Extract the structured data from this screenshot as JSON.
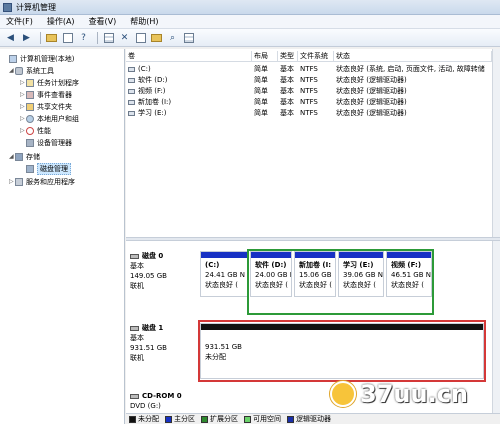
{
  "window": {
    "title": "计算机管理"
  },
  "menu": [
    "文件(F)",
    "操作(A)",
    "查看(V)",
    "帮助(H)"
  ],
  "toolbar": [
    "back-icon",
    "forward-icon",
    "sep",
    "up-folder-icon",
    "properties-icon",
    "help-icon",
    "sep",
    "grid-icon",
    "close-icon",
    "export-icon",
    "folder-icon",
    "search-icon",
    "screen-icon"
  ],
  "tree": [
    {
      "label": "计算机管理(本地)",
      "icon": "computer-icon",
      "level": 0,
      "twisty": ""
    },
    {
      "label": "系统工具",
      "icon": "tools-icon",
      "level": 1,
      "twisty": "◢"
    },
    {
      "label": "任务计划程序",
      "icon": "task-scheduler-icon",
      "level": 2,
      "twisty": "▷"
    },
    {
      "label": "事件查看器",
      "icon": "event-viewer-icon",
      "level": 2,
      "twisty": "▷"
    },
    {
      "label": "共享文件夹",
      "icon": "shared-folder-icon",
      "level": 2,
      "twisty": "▷"
    },
    {
      "label": "本地用户和组",
      "icon": "users-icon",
      "level": 2,
      "twisty": "▷"
    },
    {
      "label": "性能",
      "icon": "performance-icon",
      "level": 2,
      "twisty": "▷"
    },
    {
      "label": "设备管理器",
      "icon": "device-manager-icon",
      "level": 2,
      "twisty": ""
    },
    {
      "label": "存储",
      "icon": "storage-icon",
      "level": 1,
      "twisty": "◢"
    },
    {
      "label": "磁盘管理",
      "icon": "disk-management-icon",
      "level": 2,
      "twisty": "",
      "selected": true
    },
    {
      "label": "服务和应用程序",
      "icon": "services-icon",
      "level": 1,
      "twisty": "▷"
    }
  ],
  "volume_table": {
    "headers": [
      "卷",
      "布局",
      "类型",
      "文件系统",
      "状态"
    ],
    "rows": [
      [
        "(C:)",
        "简单",
        "基本",
        "NTFS",
        "状态良好 (系统, 启动, 页面文件, 活动, 故障转储"
      ],
      [
        "软件 (D:)",
        "简单",
        "基本",
        "NTFS",
        "状态良好 (逻辑驱动器)"
      ],
      [
        "视频 (F:)",
        "简单",
        "基本",
        "NTFS",
        "状态良好 (逻辑驱动器)"
      ],
      [
        "新加卷 (I:)",
        "简单",
        "基本",
        "NTFS",
        "状态良好 (逻辑驱动器)"
      ],
      [
        "学习 (E:)",
        "简单",
        "基本",
        "NTFS",
        "状态良好 (逻辑驱动器)"
      ]
    ]
  },
  "disks": [
    {
      "name": "磁盘 0",
      "type": "基本",
      "size": "149.05 GB",
      "status": "联机",
      "partitions": [
        {
          "name": "(C:)",
          "size": "24.41 GB N",
          "status": "状态良好 ("
        },
        {
          "name": "软件 (D:)",
          "size": "24.00 GB I",
          "status": "状态良好 ("
        },
        {
          "name": "新加卷 (I:",
          "size": "15.06 GB",
          "status": "状态良好 ("
        },
        {
          "name": "学习 (E:)",
          "size": "39.06 GB N",
          "status": "状态良好 ("
        },
        {
          "name": "视频 (F:)",
          "size": "46.51 GB N",
          "status": "状态良好 ("
        }
      ]
    },
    {
      "name": "磁盘 1",
      "type": "基本",
      "size": "931.51 GB",
      "status": "联机",
      "partitions": [
        {
          "name": "",
          "size": "931.51 GB",
          "status": "未分配"
        }
      ]
    },
    {
      "name": "CD-ROM 0",
      "type": "DVD (G:)",
      "size": "",
      "status": ""
    }
  ],
  "legend": [
    {
      "label": "未分配",
      "color": "#111111"
    },
    {
      "label": "主分区",
      "color": "#1731c4"
    },
    {
      "label": "扩展分区",
      "color": "#2f8a2f"
    },
    {
      "label": "可用空间",
      "color": "#6ad26a"
    },
    {
      "label": "逻辑驱动器",
      "color": "#1a2fa8"
    }
  ],
  "watermark": "37uu.cn"
}
